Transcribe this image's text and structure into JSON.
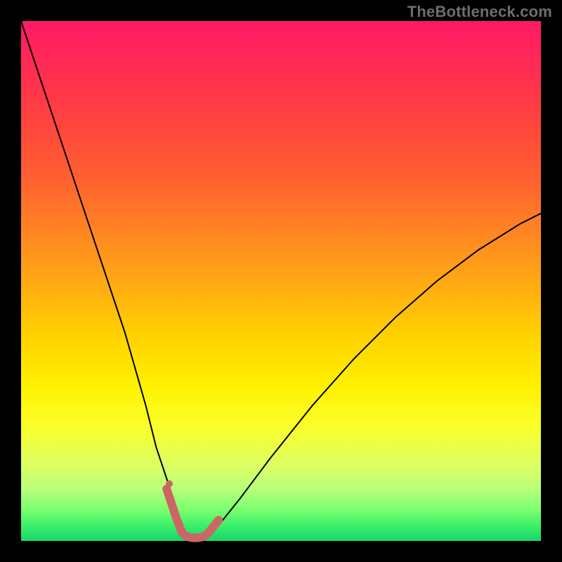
{
  "watermark": "TheBottleneck.com",
  "chart_data": {
    "type": "line",
    "title": "",
    "xlabel": "",
    "ylabel": "",
    "xlim": [
      0,
      100
    ],
    "ylim": [
      0,
      100
    ],
    "grid": false,
    "legend": false,
    "background_gradient": {
      "direction": "vertical",
      "stops": [
        {
          "pos": 0.0,
          "color": "#ff1a66"
        },
        {
          "pos": 0.18,
          "color": "#ff4040"
        },
        {
          "pos": 0.42,
          "color": "#ff8a20"
        },
        {
          "pos": 0.6,
          "color": "#ffd000"
        },
        {
          "pos": 0.78,
          "color": "#fbff2a"
        },
        {
          "pos": 0.92,
          "color": "#8bff72"
        },
        {
          "pos": 1.0,
          "color": "#17d66a"
        }
      ]
    },
    "series": [
      {
        "name": "bottleneck-curve",
        "color": "#000000",
        "stroke_width": 2,
        "x": [
          0,
          4,
          8,
          12,
          16,
          20,
          24,
          26,
          28,
          30,
          31,
          32,
          33,
          34,
          35,
          36,
          38,
          42,
          48,
          56,
          64,
          72,
          80,
          88,
          96,
          100
        ],
        "y": [
          100,
          88,
          76,
          64,
          52,
          40,
          26,
          18,
          12,
          6,
          3,
          1,
          0.5,
          0.5,
          0.5,
          1,
          3,
          8,
          16,
          26,
          35,
          43,
          50,
          56,
          61,
          63
        ]
      },
      {
        "name": "highlight-valley",
        "color": "#cc6666",
        "stroke_width": 12,
        "linecap": "round",
        "x": [
          28,
          30,
          31,
          32,
          33,
          34,
          35,
          36,
          38
        ],
        "y": [
          10,
          4,
          1.5,
          0.8,
          0.6,
          0.6,
          0.8,
          1.5,
          4
        ]
      }
    ],
    "annotations": [
      {
        "type": "dot",
        "x": 28.5,
        "y": 11,
        "r": 5,
        "color": "#cc6666"
      }
    ]
  }
}
